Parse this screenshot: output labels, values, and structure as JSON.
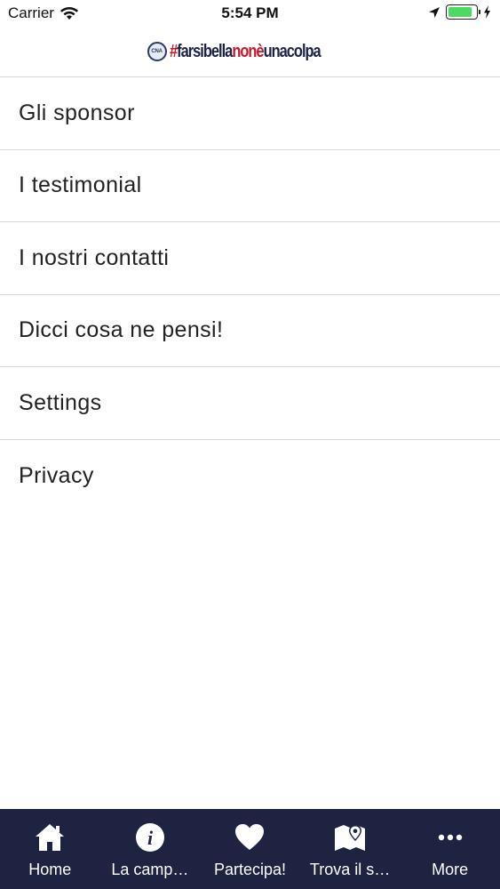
{
  "status_bar": {
    "carrier": "Carrier",
    "time": "5:54 PM",
    "battery_level": 0.85,
    "battery_color": "#4cd964"
  },
  "header": {
    "logo_badge": "CNA",
    "logo_hash": "#",
    "logo_part1": "farsibella",
    "logo_part2": "nonè",
    "logo_part3": "unacolpa"
  },
  "menu": {
    "items": [
      {
        "label": "Gli sponsor"
      },
      {
        "label": "I testimonial"
      },
      {
        "label": "I nostri contatti"
      },
      {
        "label": "Dicci cosa ne pensi!"
      },
      {
        "label": "Settings"
      },
      {
        "label": "Privacy"
      }
    ]
  },
  "tab_bar": {
    "background": "#1d2340",
    "tabs": [
      {
        "label": "Home",
        "icon": "home-icon"
      },
      {
        "label": "La camp…",
        "icon": "info-icon"
      },
      {
        "label": "Partecipa!",
        "icon": "heart-icon"
      },
      {
        "label": "Trova il s…",
        "icon": "map-icon"
      },
      {
        "label": "More",
        "icon": "more-icon"
      }
    ]
  }
}
